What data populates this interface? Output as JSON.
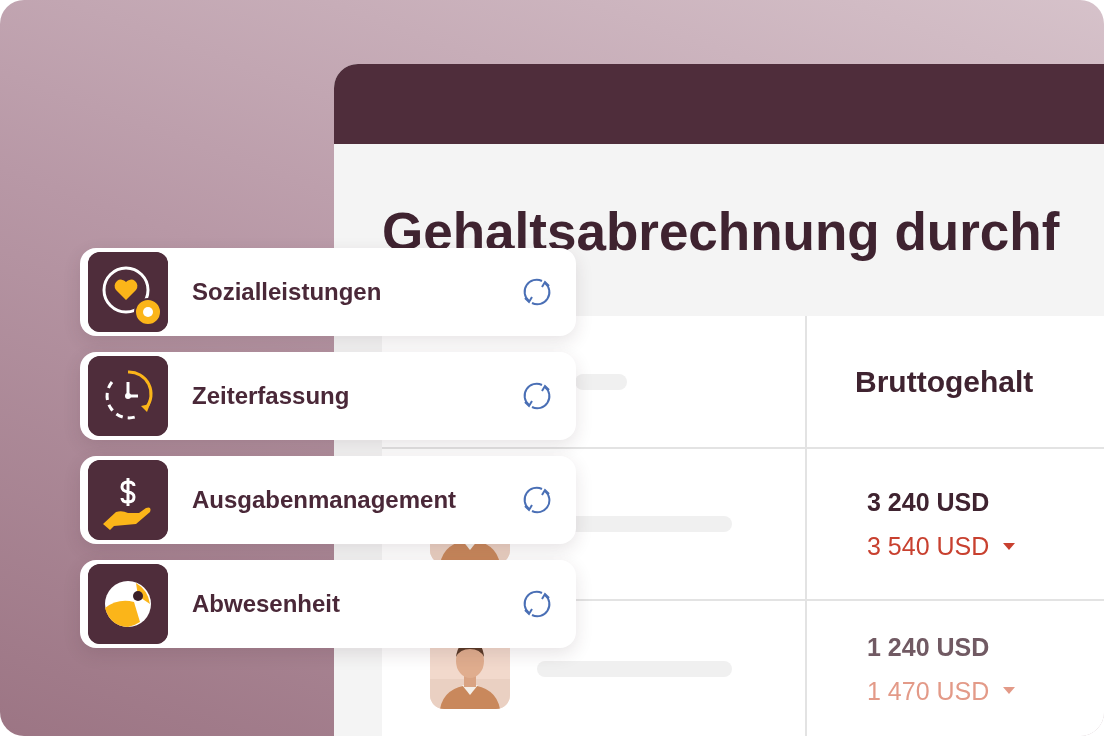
{
  "window": {
    "title": "Gehaltsabrechnung durchf"
  },
  "table": {
    "header": "Bruttogehalt",
    "rows": [
      {
        "dimmed": false,
        "amount": "3 240 USD",
        "new_amount": "3 540 USD"
      },
      {
        "dimmed": true,
        "amount": "1 240 USD",
        "new_amount": "1 470 USD"
      }
    ]
  },
  "integrations": [
    {
      "kind": "benefits",
      "label": "Sozialleistungen"
    },
    {
      "kind": "time",
      "label": "Zeiterfassung"
    },
    {
      "kind": "expenses",
      "label": "Ausgabenmanagement"
    },
    {
      "kind": "absence",
      "label": "Abwesenheit"
    }
  ]
}
